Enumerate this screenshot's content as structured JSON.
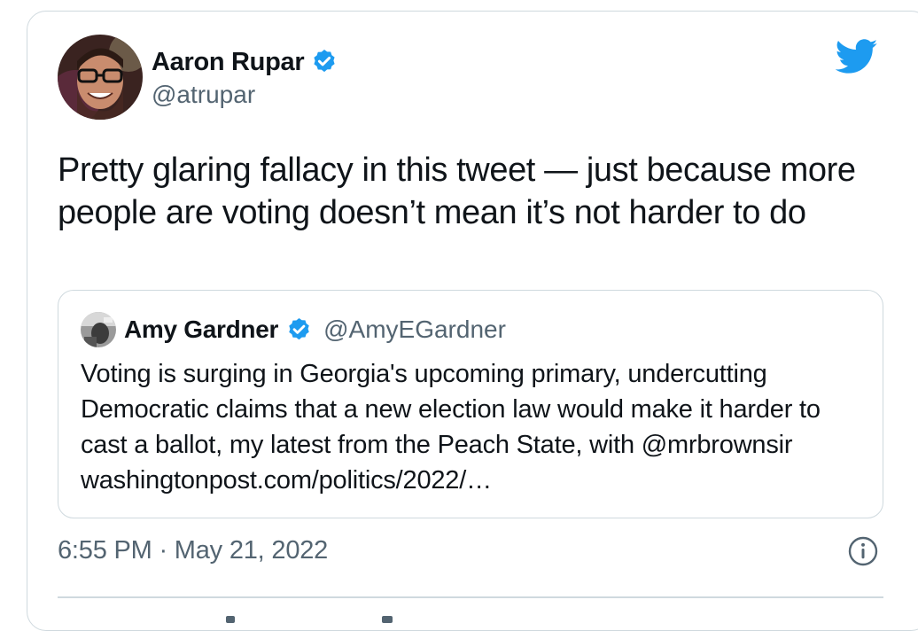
{
  "tweet": {
    "author_name": "Aaron Rupar",
    "author_handle": "@atrupar",
    "text": "Pretty glaring fallacy in this tweet — just because more people are voting doesn’t mean it’s not harder to do",
    "timestamp": "6:55 PM · May 21, 2022"
  },
  "quoted_tweet": {
    "author_name": "Amy Gardner",
    "author_handle": "@AmyEGardner",
    "text": "Voting is surging in Georgia's upcoming primary, undercutting Democratic claims that a new election law would make it harder to cast a ballot, my latest from the Peach State, with @mrbrownsir washingtonpost.com/politics/2022/…"
  },
  "icons": {
    "verified": "verified-badge-icon",
    "brand": "twitter-bird-icon",
    "info": "info-icon"
  },
  "colors": {
    "twitter_blue": "#1d9bf0",
    "secondary_text": "#536471",
    "border": "#cfd9de"
  }
}
